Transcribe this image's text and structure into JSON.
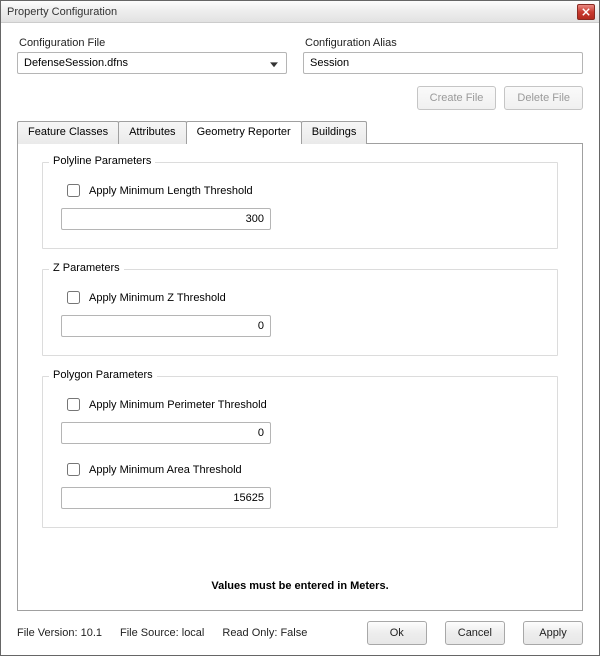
{
  "window": {
    "title": "Property Configuration"
  },
  "config": {
    "file_label": "Configuration File",
    "file_value": "DefenseSession.dfns",
    "alias_label": "Configuration Alias",
    "alias_value": "Session",
    "create_file_btn": "Create File",
    "delete_file_btn": "Delete File"
  },
  "tabs": {
    "feature_classes": "Feature Classes",
    "attributes": "Attributes",
    "geometry_reporter": "Geometry Reporter",
    "buildings": "Buildings",
    "active": "geometry_reporter"
  },
  "geometry": {
    "polyline": {
      "legend": "Polyline Parameters",
      "min_length_label": "Apply Minimum Length Threshold",
      "min_length_checked": false,
      "min_length_value": "300"
    },
    "z": {
      "legend": "Z Parameters",
      "min_z_label": "Apply Minimum Z Threshold",
      "min_z_checked": false,
      "min_z_value": "0"
    },
    "polygon": {
      "legend": "Polygon Parameters",
      "min_perimeter_label": "Apply Minimum Perimeter Threshold",
      "min_perimeter_checked": false,
      "min_perimeter_value": "0",
      "min_area_label": "Apply Minimum Area Threshold",
      "min_area_checked": false,
      "min_area_value": "15625"
    },
    "hint": "Values must be entered in Meters."
  },
  "status": {
    "file_version": "File Version: 10.1",
    "file_source": "File Source: local",
    "read_only": "Read Only: False"
  },
  "buttons": {
    "ok": "Ok",
    "cancel": "Cancel",
    "apply": "Apply"
  }
}
